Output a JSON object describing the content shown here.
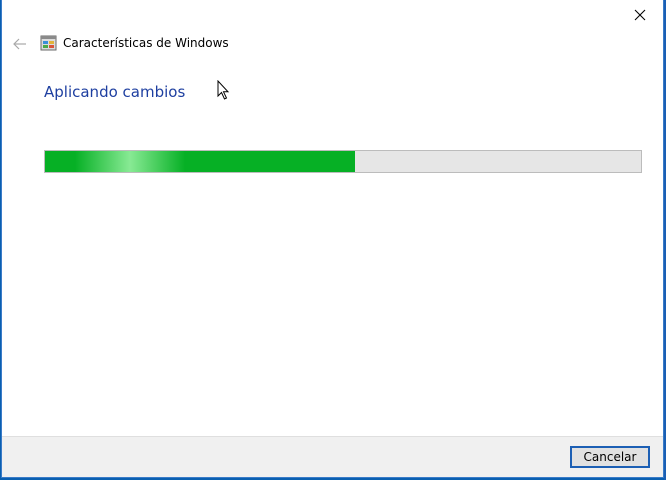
{
  "window": {
    "title": "Características de Windows"
  },
  "heading": "Aplicando cambios",
  "progress": {
    "percent": 52
  },
  "buttons": {
    "cancel_label": "Cancelar"
  },
  "icons": {
    "back": "back-arrow-icon",
    "close": "close-icon",
    "app": "windows-features-icon",
    "cursor": "mouse-pointer-icon"
  },
  "colors": {
    "heading": "#1e3fa0",
    "progress_fill": "#06b025",
    "progress_track": "#e6e6e6",
    "button_border": "#1c5fb4",
    "desktop": "#0a5fb0"
  }
}
